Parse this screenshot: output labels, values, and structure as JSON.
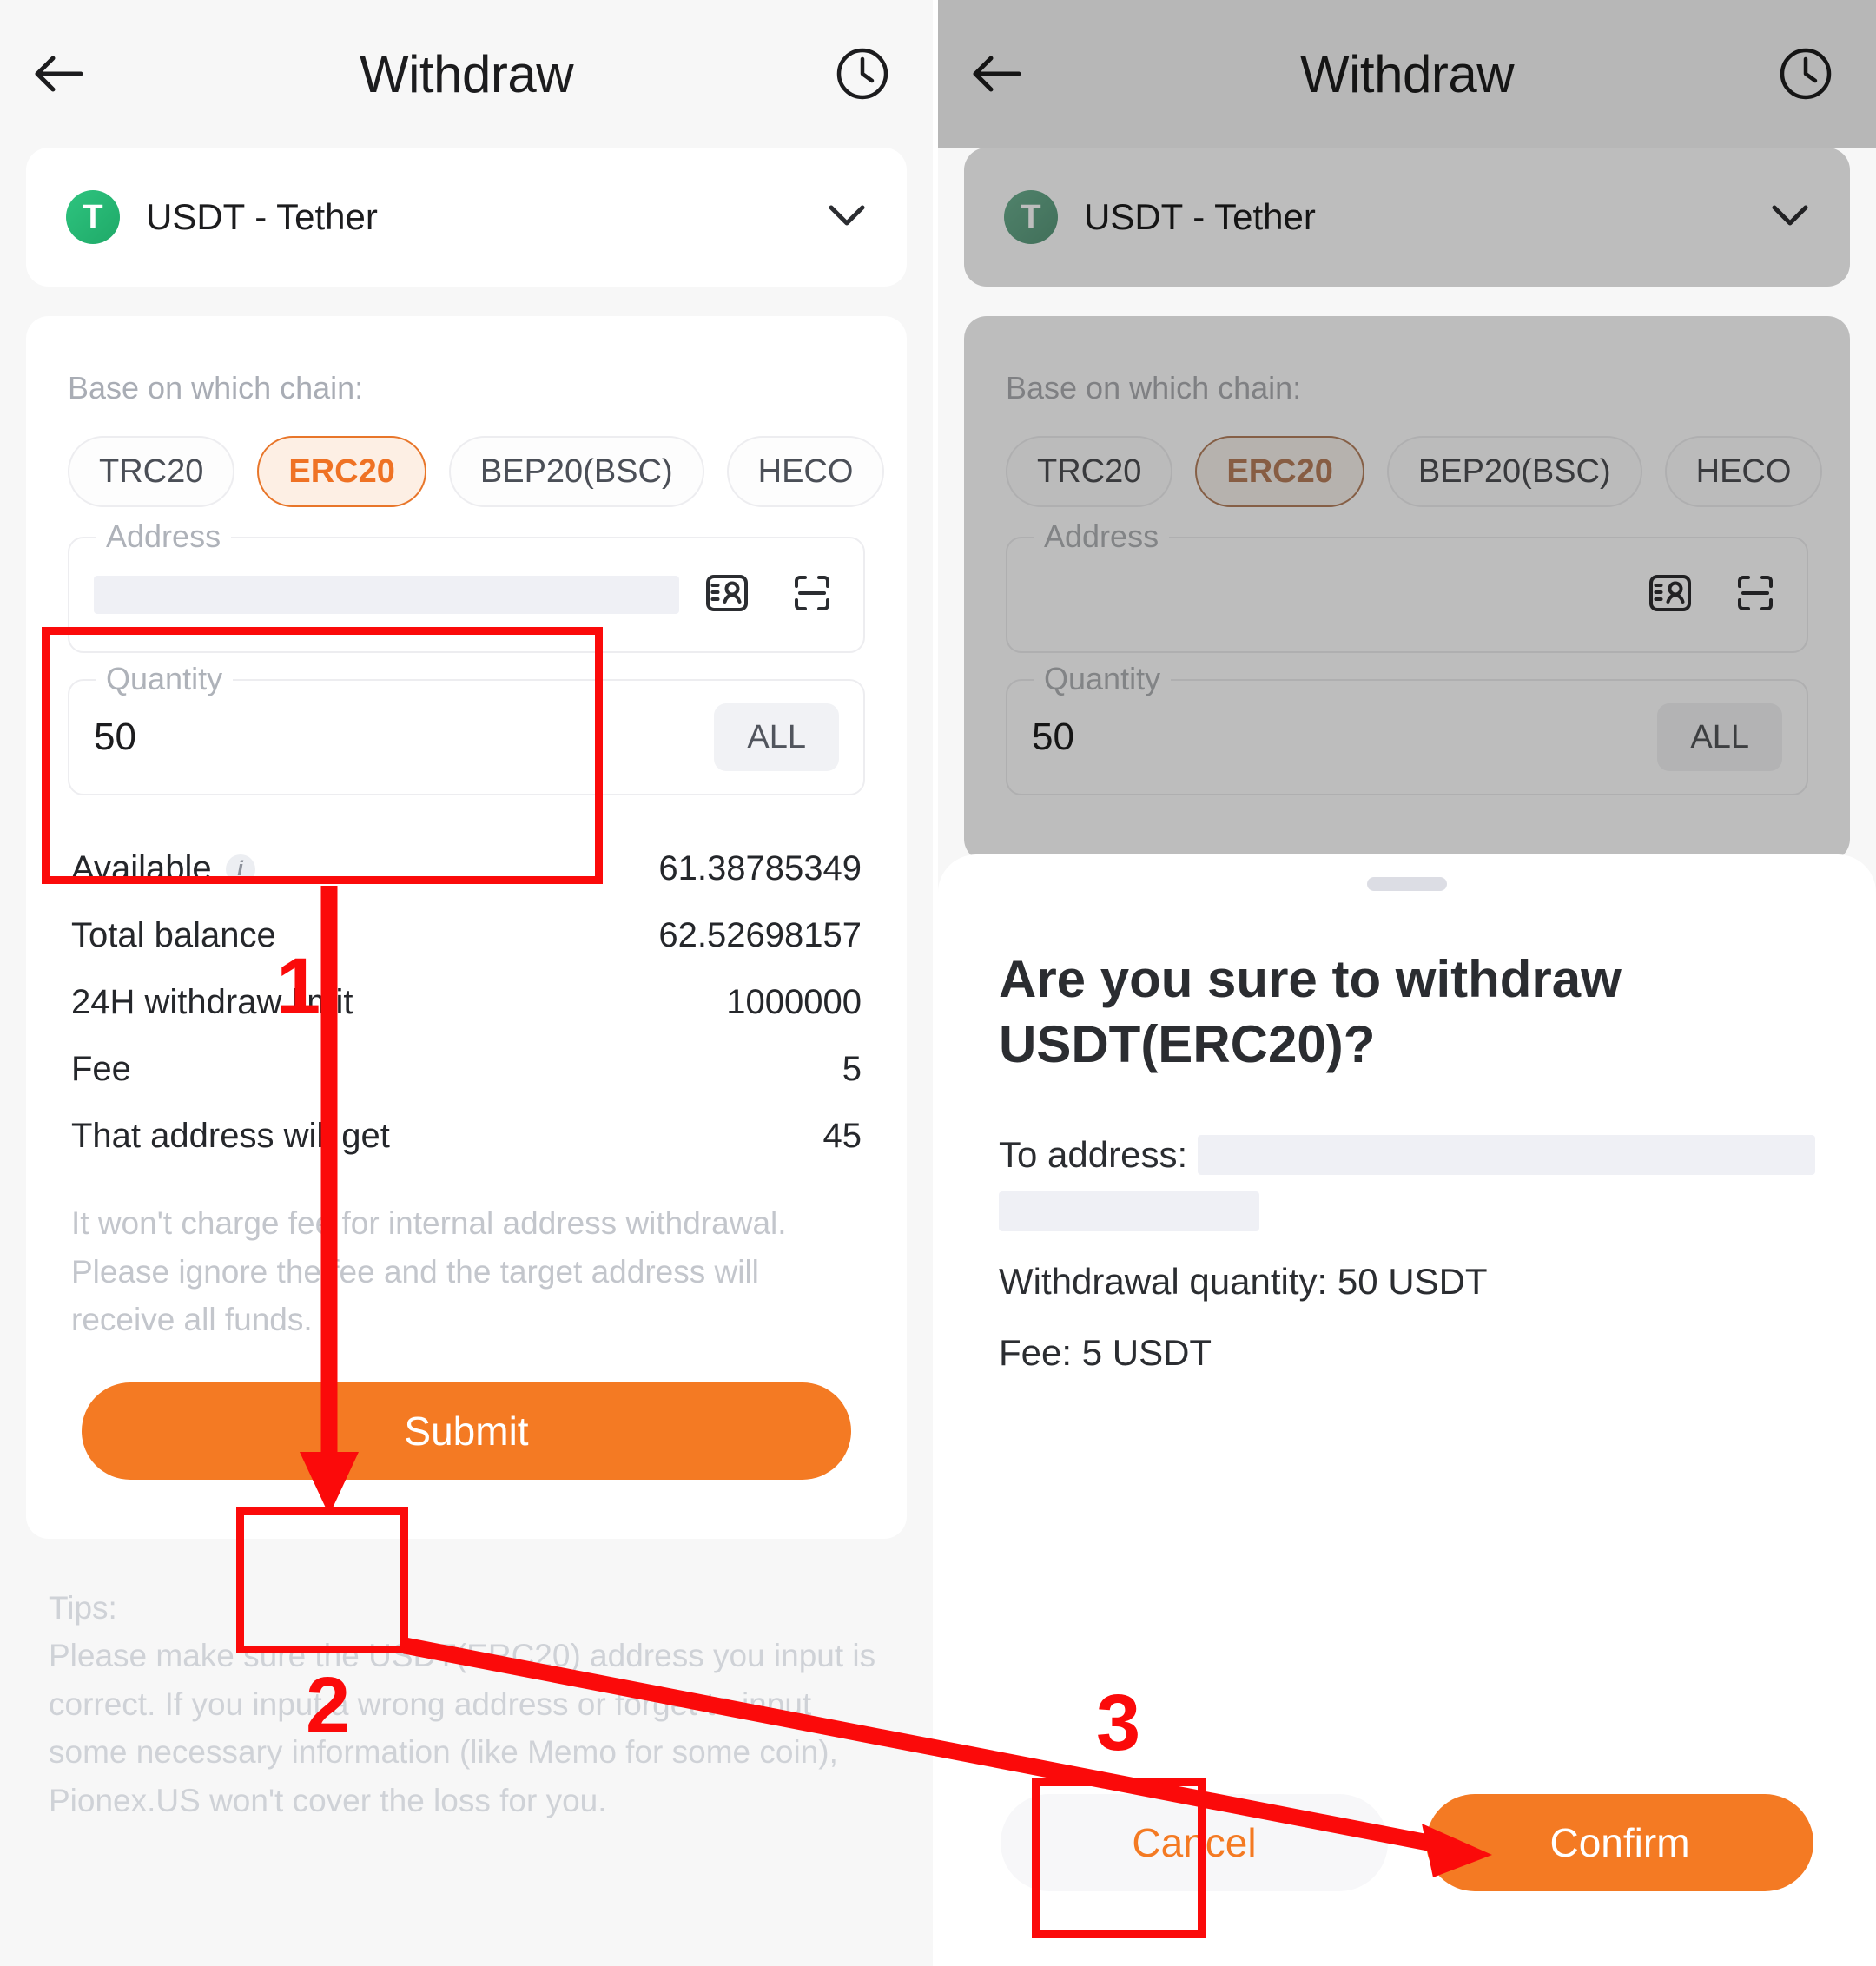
{
  "header": {
    "title": "Withdraw",
    "back_icon": "arrow-left-icon",
    "history_icon": "clock-icon"
  },
  "coin_selector": {
    "symbol": "T",
    "label": "USDT - Tether",
    "caret_icon": "chevron-down-icon"
  },
  "form": {
    "chain_label": "Base on which chain:",
    "chains": [
      {
        "label": "TRC20",
        "active": false
      },
      {
        "label": "ERC20",
        "active": true
      },
      {
        "label": "BEP20(BSC)",
        "active": false
      },
      {
        "label": "HECO",
        "active": false
      }
    ],
    "address_field": {
      "legend": "Address",
      "value": "",
      "redacted": true,
      "contacts_icon": "contact-card-icon",
      "scan_icon": "qr-scan-icon"
    },
    "quantity_field": {
      "legend": "Quantity",
      "value": "50",
      "all_label": "ALL"
    }
  },
  "info_rows": [
    {
      "label": "Available",
      "value": "61.38785349",
      "has_info_icon": true
    },
    {
      "label": "Total balance",
      "value": "62.52698157",
      "has_info_icon": false
    },
    {
      "label": "24H withdraw limit",
      "value": "1000000",
      "has_info_icon": false
    },
    {
      "label": "Fee",
      "value": "5",
      "has_info_icon": false
    },
    {
      "label": "That address will get",
      "value": "45",
      "has_info_icon": false
    }
  ],
  "note": "It won't charge fee for internal address withdrawal. Please ignore the fee and the target address will receive all funds.",
  "submit": {
    "label": "Submit"
  },
  "tips": {
    "heading": "Tips:",
    "body": "Please make sure the USDT(ERC20) address you input is correct. If you input a wrong address or forget to input some necessary information (like Memo for some coin), Pionex.US won't cover the loss for you."
  },
  "confirm_sheet": {
    "title": "Are you sure to withdraw USDT(ERC20)?",
    "to_address_label": "To address:",
    "to_address_value": "",
    "quantity_line": "Withdrawal quantity: 50 USDT",
    "fee_line": "Fee: 5 USDT",
    "cancel_label": "Cancel",
    "confirm_label": "Confirm"
  },
  "annotations": {
    "step1": "1",
    "step2": "2",
    "step3": "3"
  },
  "colors": {
    "accent": "#f47a23",
    "accent_chip_text": "#ef7224",
    "annotation_red": "#fb0a0a",
    "tether_green": "#26a17b",
    "page_bg": "#f7f7f7",
    "card_bg": "#ffffff"
  }
}
